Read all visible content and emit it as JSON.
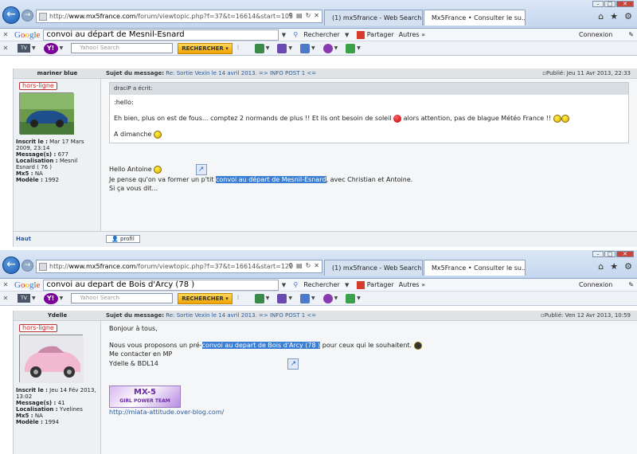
{
  "screens": [
    {
      "address": {
        "host": "www.mx5france.com",
        "prefix": "http://",
        "path": "/forum/viewtopic.php?f=37&t=16614&start=105"
      },
      "tabs": [
        {
          "label": "(1) mx5france - Web Search Re..."
        },
        {
          "label": "Mx5France • Consulter le su..."
        }
      ],
      "google": {
        "logo": "Google",
        "query": "convoi au départ de Mesnil-Esnard",
        "search_label": "Rechercher",
        "share_label": "Partager",
        "more_label": "Autres »",
        "login_label": "Connexion"
      },
      "yahoo": {
        "search_placeholder": "Yahoo! Search",
        "search_button": "RECHERCHER"
      },
      "post": {
        "author": "mariner blue",
        "subject_prefix": "Sujet du message:",
        "subject": "Re: Sortie Vexin le 14 avril 2013. => INFO POST 1 <=",
        "published": "Publié: Jeu 11 Avr 2013, 22:33",
        "status": "hors-ligne",
        "profile": [
          {
            "k": "Inscrit le :",
            "v": " Mar 17 Mars 2009, 23:14"
          },
          {
            "k": "Message(s) :",
            "v": " 677"
          },
          {
            "k": "Localisation :",
            "v": " Mesnil Esnard ( 76 )"
          },
          {
            "k": "Mx5 :",
            "v": " NA"
          },
          {
            "k": "Modèle :",
            "v": " 1992"
          }
        ],
        "quote_header": "draciP a écrit:",
        "quote_lines": [
          ":hello:",
          "Eh bien, plus on est de fous... comptez 2 normands de plus !! Et ils ont besoin de soleil",
          " alors attention, pas de blague Météo France !!",
          "A dimanche"
        ],
        "hello": "Hello Antoine",
        "line2_pre": "Je pense qu'on va former un p'tit ",
        "line2_hl": "convoi au départ de Mesnil-Esnard",
        "line2_post": ", avec Christian et Antoine.",
        "line3": "Si ça vous dit...",
        "back_top": "Haut",
        "profile_btn": "profil"
      }
    },
    {
      "address": {
        "host": "www.mx5france.com",
        "prefix": "http://",
        "path": "/forum/viewtopic.php?f=37&t=16614&start=120"
      },
      "tabs": [
        {
          "label": "(1) mx5france - Web Search Re..."
        },
        {
          "label": "Mx5France • Consulter le su..."
        }
      ],
      "google": {
        "logo": "Google",
        "query": "convoi au depart de Bois d'Arcy (78 )",
        "search_label": "Rechercher",
        "share_label": "Partager",
        "more_label": "Autres »",
        "login_label": "Connexion"
      },
      "yahoo": {
        "search_placeholder": "Yahoo! Search",
        "search_button": "RECHERCHER"
      },
      "post": {
        "author": "Ydelle",
        "subject_prefix": "Sujet du message:",
        "subject": "Re: Sortie Vexin le 14 avril 2013. => INFO POST 1 <=",
        "published": "Publié: Ven 12 Avr 2013, 10:59",
        "status": "hors-ligne",
        "profile": [
          {
            "k": "Inscrit le :",
            "v": " Jeu 14 Fév 2013, 13:02"
          },
          {
            "k": "Message(s) :",
            "v": " 41"
          },
          {
            "k": "Localisation :",
            "v": " Yvelines"
          },
          {
            "k": "Mx5 :",
            "v": " NA"
          },
          {
            "k": "Modèle :",
            "v": " 1994"
          }
        ],
        "greeting": "Bonjour à tous,",
        "line1_pre": "Nous vous proposons un pré-",
        "line1_hl": "convoi au depart de Bois d'Arcy (78 )",
        "line1_post": " pour ceux qui le souhaitent.",
        "line2": "Me contacter en MP",
        "line3": "Ydelle & BDL14",
        "banner_line1": "MX-5",
        "banner_line2": "GIRL POWER TEAM",
        "link": "http://miata-attitude.over-blog.com/"
      }
    }
  ]
}
